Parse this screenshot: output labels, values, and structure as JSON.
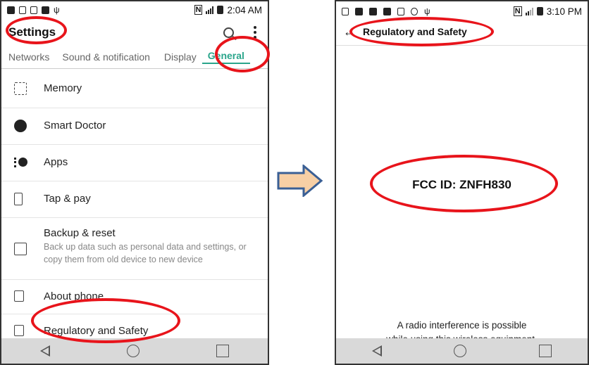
{
  "left": {
    "status_time": "2:04 AM",
    "title": "Settings",
    "tabs": [
      {
        "label": "Networks",
        "active": false
      },
      {
        "label": "Sound & notification",
        "active": false
      },
      {
        "label": "Display",
        "active": false
      },
      {
        "label": "General",
        "active": true
      }
    ],
    "items": [
      {
        "label": "Memory",
        "icon": "memory-chip-icon"
      },
      {
        "label": "Smart Doctor",
        "icon": "smart-doctor-icon"
      },
      {
        "label": "Apps",
        "icon": "apps-icon"
      },
      {
        "label": "Tap & pay",
        "icon": "tap-pay-icon"
      },
      {
        "label": "Backup & reset",
        "sub": "Back up data such as personal data and settings, or copy them from old device to new device",
        "icon": "backup-icon"
      },
      {
        "label": "About phone",
        "icon": "info-icon"
      },
      {
        "label": "Regulatory and Safety",
        "icon": "regulatory-icon"
      }
    ]
  },
  "right": {
    "status_time": "3:10 PM",
    "title": "Regulatory and Safety",
    "fcc_id": "FCC ID: ZNFH830",
    "interference_line1": "A radio interference is possible",
    "interference_line2": "while using this wireless equipment."
  },
  "colors": {
    "accent": "#2aa58b",
    "annotation": "#e8141b",
    "arrow_fill": "#f7cfa5",
    "arrow_stroke": "#3a5f95",
    "navbar": "#d9d9d9"
  }
}
